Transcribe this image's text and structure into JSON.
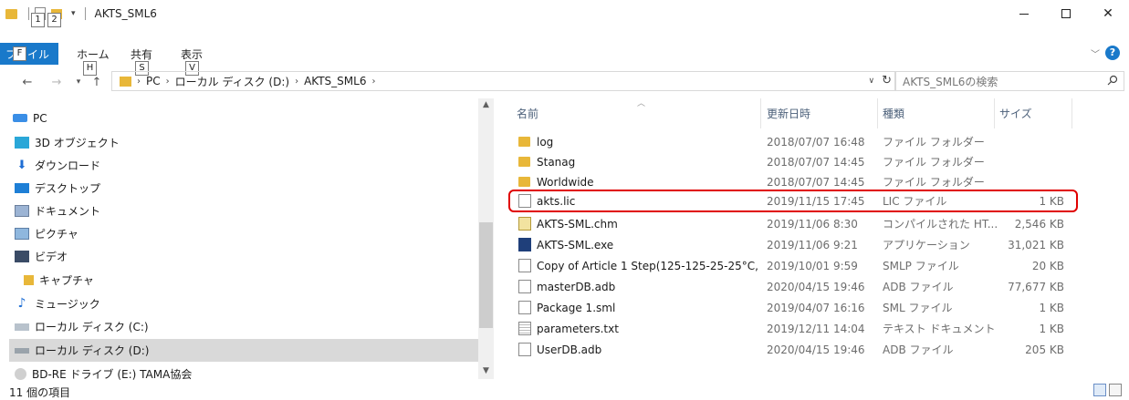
{
  "window": {
    "title": "AKTS_SML6",
    "keytips": {
      "qa1": "1",
      "qa2": "2",
      "file": "F",
      "home": "H",
      "share": "S",
      "view": "V"
    }
  },
  "ribbon": {
    "file_tab": "ファイル",
    "tabs": [
      "ホーム",
      "共有",
      "表示"
    ]
  },
  "address": {
    "crumbs": [
      "PC",
      "ローカル ディスク (D:)",
      "AKTS_SML6"
    ]
  },
  "search": {
    "placeholder": "AKTS_SML6の検索"
  },
  "nav": {
    "items": [
      {
        "label": "PC",
        "icon": "pc-icon"
      },
      {
        "label": "3D オブジェクト",
        "icon": "3d-objects-icon"
      },
      {
        "label": "ダウンロード",
        "icon": "download-icon"
      },
      {
        "label": "デスクトップ",
        "icon": "desktop-icon"
      },
      {
        "label": "ドキュメント",
        "icon": "documents-icon"
      },
      {
        "label": "ピクチャ",
        "icon": "pictures-icon"
      },
      {
        "label": "ビデオ",
        "icon": "videos-icon"
      },
      {
        "label": "キャプチャ",
        "icon": "folder-icon"
      },
      {
        "label": "ミュージック",
        "icon": "music-icon"
      },
      {
        "label": "ローカル ディスク (C:)",
        "icon": "drive-c-icon"
      },
      {
        "label": "ローカル ディスク (D:)",
        "icon": "drive-d-icon"
      },
      {
        "label": "BD-RE ドライブ (E:) TAMA協会",
        "icon": "optical-drive-icon"
      }
    ]
  },
  "columns": {
    "name": "名前",
    "date": "更新日時",
    "type": "種類",
    "size": "サイズ"
  },
  "files": [
    {
      "name": "log",
      "date": "2018/07/07 16:48",
      "type": "ファイル フォルダー",
      "size": "",
      "icon": "folder-icon"
    },
    {
      "name": "Stanag",
      "date": "2018/07/07 14:45",
      "type": "ファイル フォルダー",
      "size": "",
      "icon": "folder-icon"
    },
    {
      "name": "Worldwide",
      "date": "2018/07/07 14:45",
      "type": "ファイル フォルダー",
      "size": "",
      "icon": "folder-icon"
    },
    {
      "name": "akts.lic",
      "date": "2019/11/15 17:45",
      "type": "LIC ファイル",
      "size": "1 KB",
      "icon": "file-icon"
    },
    {
      "name": "AKTS-SML.chm",
      "date": "2019/11/06 8:30",
      "type": "コンパイルされた HT...",
      "size": "2,546 KB",
      "icon": "help-file-icon"
    },
    {
      "name": "AKTS-SML.exe",
      "date": "2019/11/06 9:21",
      "type": "アプリケーション",
      "size": "31,021 KB",
      "icon": "sml-app-icon"
    },
    {
      "name": "Copy of Article 1 Step(125-125-25-25°C, ...",
      "date": "2019/10/01 9:59",
      "type": "SMLP ファイル",
      "size": "20 KB",
      "icon": "file-icon"
    },
    {
      "name": "masterDB.adb",
      "date": "2020/04/15 19:46",
      "type": "ADB ファイル",
      "size": "77,677 KB",
      "icon": "file-icon"
    },
    {
      "name": "Package 1.sml",
      "date": "2019/04/07 16:16",
      "type": "SML ファイル",
      "size": "1 KB",
      "icon": "file-icon"
    },
    {
      "name": "parameters.txt",
      "date": "2019/12/11 14:04",
      "type": "テキスト ドキュメント",
      "size": "1 KB",
      "icon": "text-file-icon"
    },
    {
      "name": "UserDB.adb",
      "date": "2020/04/15 19:46",
      "type": "ADB ファイル",
      "size": "205 KB",
      "icon": "file-icon"
    }
  ],
  "status": {
    "item_count": "11 個の項目"
  },
  "colors": {
    "accent": "#1979ca",
    "highlight": "#e00000",
    "folder": "#e8b739",
    "selected": "#d9d9d9"
  }
}
